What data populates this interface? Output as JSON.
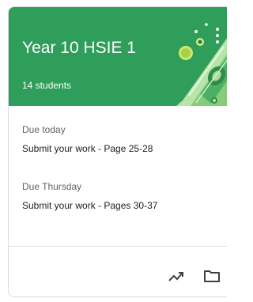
{
  "card": {
    "title": "Year 10 HSIE 1",
    "subtitle": "14 students",
    "header_color": "#2e9e5a"
  },
  "assignments": [
    {
      "due": "Due today",
      "title": "Submit your work - Page 25-28"
    },
    {
      "due": "Due Thursday",
      "title": "Submit your work - Pages 30-37"
    }
  ],
  "footer": {
    "icons": [
      "trending-up-icon",
      "folder-icon"
    ]
  },
  "header_icons": [
    "more-vert-icon"
  ]
}
